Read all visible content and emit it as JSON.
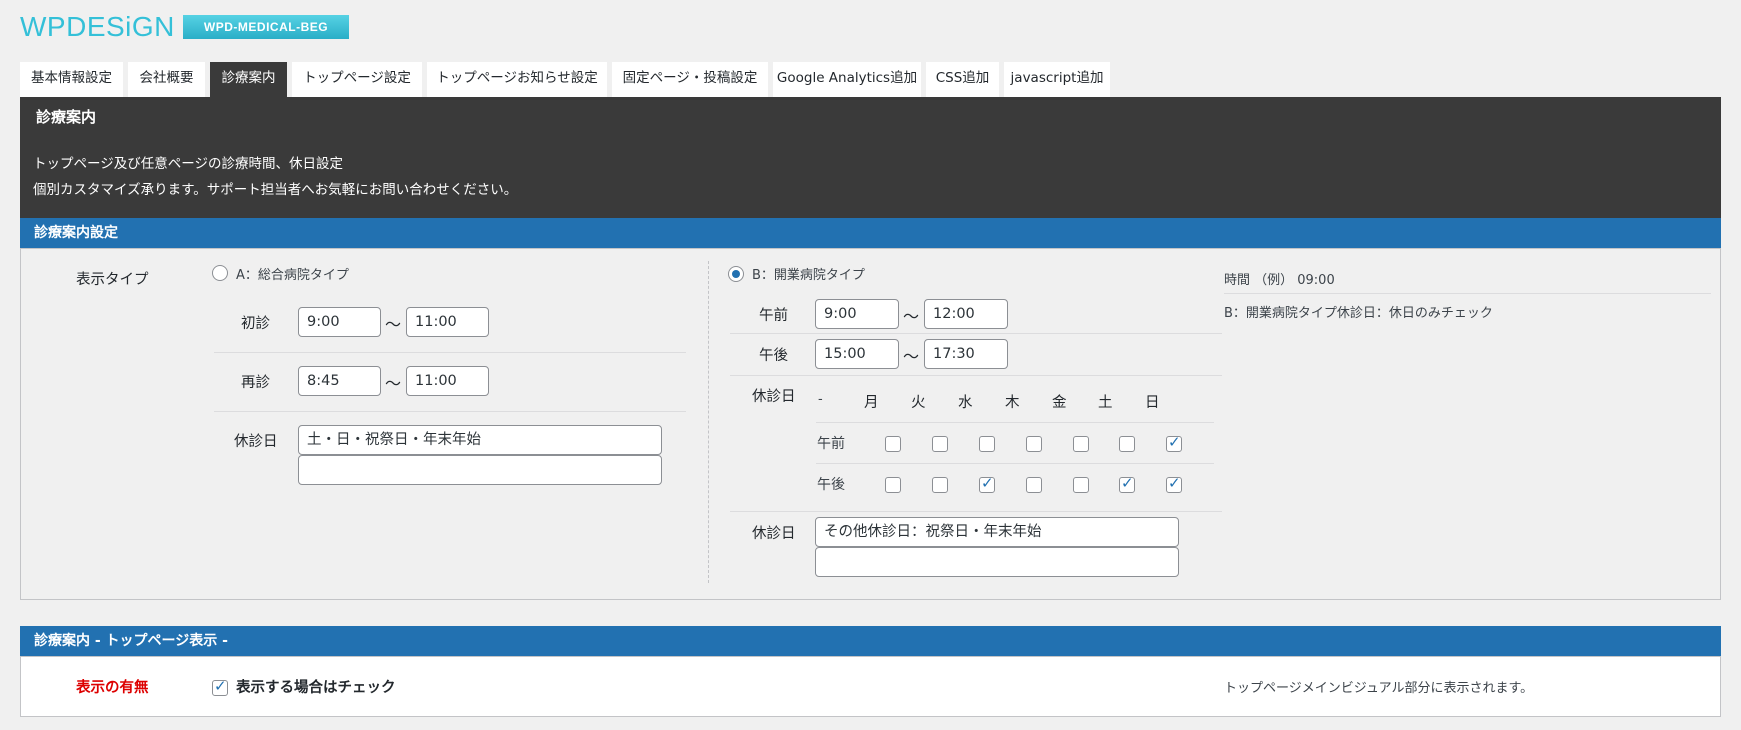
{
  "header": {
    "logo_text": "WPDESiGN",
    "badge": "WPD-MEDICAL-BEG"
  },
  "tabs": [
    {
      "label": "基本情報設定"
    },
    {
      "label": "会社概要"
    },
    {
      "label": "診療案内",
      "active": true
    },
    {
      "label": "トップページ設定"
    },
    {
      "label": "トップページお知らせ設定"
    },
    {
      "label": "固定ページ・投稿設定"
    },
    {
      "label": "Google Analytics追加"
    },
    {
      "label": "CSS追加"
    },
    {
      "label": "javascript追加"
    }
  ],
  "intro": {
    "title": "診療案内",
    "line1": "トップページ及び任意ページの診療時間、休日設定",
    "line2": "個別カスタマイズ承ります。サポート担当者へお気軽にお問い合わせください。"
  },
  "section1": {
    "title": "診療案内設定",
    "display_type_label": "表示タイプ",
    "typeA": {
      "label": "A：総合病院タイプ",
      "selected": false,
      "first_visit_label": "初診",
      "first_visit_from": "9:00",
      "first_visit_to": "11:00",
      "revisit_label": "再診",
      "revisit_from": "8:45",
      "revisit_to": "11:00",
      "holiday_label": "休診日",
      "holiday_line1": "土・日・祝祭日・年末年始",
      "holiday_line2": ""
    },
    "typeB": {
      "label": "B：開業病院タイプ",
      "selected": true,
      "am_label": "午前",
      "am_from": "9:00",
      "am_to": "12:00",
      "pm_label": "午後",
      "pm_from": "15:00",
      "pm_to": "17:30",
      "closed_label": "休診日",
      "grid_header_dash": "-",
      "weekdays": [
        "月",
        "火",
        "水",
        "木",
        "金",
        "土",
        "日"
      ],
      "grid_rows": [
        {
          "label": "午前",
          "checks": [
            false,
            false,
            false,
            false,
            false,
            false,
            true
          ]
        },
        {
          "label": "午後",
          "checks": [
            false,
            false,
            true,
            false,
            false,
            true,
            true
          ]
        }
      ],
      "other_holiday_label": "休診日",
      "other_holiday_line1": "その他休診日：祝祭日・年末年始",
      "other_holiday_line2": ""
    },
    "tilde": "〜",
    "notes": {
      "time_example": "時間 （例） 09:00",
      "typeB_note": "B：開業病院タイプ休診日：休日のみチェック"
    }
  },
  "section2": {
    "title": "診療案内 - トップページ表示 -",
    "show_label": "表示の有無",
    "checkbox_label": "表示する場合はチェック",
    "checked": true,
    "note": "トップページメインビジュアル部分に表示されます。"
  },
  "colors": {
    "accent_blue": "#2271b1",
    "dark_panel": "#3a3a3a",
    "logo_cyan": "#34c0d8",
    "required_red": "#dd0000"
  }
}
